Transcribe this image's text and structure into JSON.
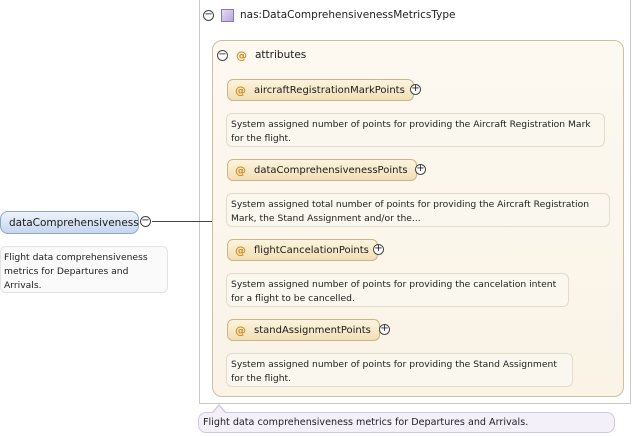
{
  "element": {
    "name": "dataComprehensiveness",
    "description": "Flight data comprehensiveness metrics for Departures and Arrivals.",
    "description_lines": [
      "Flight data comprehensiveness",
      "metrics for Departures and",
      "Arrivals."
    ]
  },
  "type": {
    "name": "nas:DataComprehensivenessMetricsType",
    "description": "Flight data comprehensiveness metrics for Departures and Arrivals."
  },
  "attributes_group": {
    "label": "attributes",
    "symbol": "@",
    "items": [
      {
        "name": "aircraftRegistrationMarkPoints",
        "desc_lines": [
          "System assigned number of points for providing the Aircraft Registration Mark",
          "for the flight."
        ]
      },
      {
        "name": "dataComprehensivenessPoints",
        "desc_lines": [
          "System assigned total number of points for providing the Aircraft Registration",
          "Mark, the Stand Assignment and/or the..."
        ]
      },
      {
        "name": "flightCancelationPoints",
        "desc_lines": [
          "System assigned number of points for providing the cancelation intent",
          "for a flight to be cancelled."
        ]
      },
      {
        "name": "standAssignmentPoints",
        "desc_lines": [
          "System assigned number of points for providing the Stand Assignment",
          "for the flight."
        ]
      }
    ]
  },
  "symbols": {
    "collapse": "−",
    "expand": "+"
  }
}
